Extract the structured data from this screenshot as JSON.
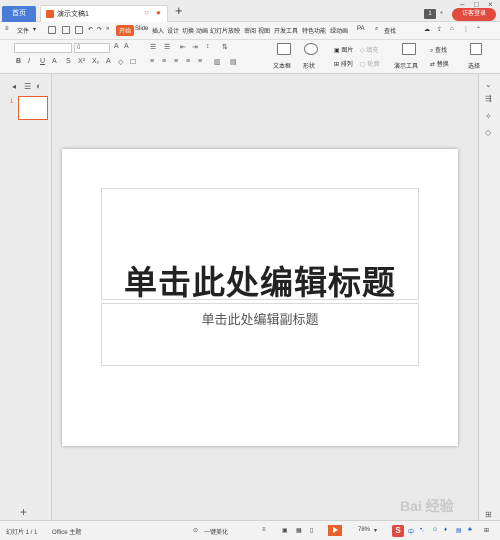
{
  "titlebar": {
    "home_tab": "首页",
    "doc_tab": "演示文稿1",
    "add_tab": "+",
    "badge": "1",
    "login": "访客登录",
    "min": "–",
    "max": "□",
    "close": "×"
  },
  "menu": {
    "file": "文件",
    "tabs": [
      "开始",
      "Slide",
      "插入",
      "设计",
      "切换",
      "动画",
      "幻灯片放映",
      "审阅",
      "视图",
      "开发工具",
      "特色功能",
      "绿动画",
      "PA"
    ],
    "search": "查找"
  },
  "ribbon": {
    "font_size": "0",
    "textbox": "文本框",
    "shape": "形状",
    "picture": "图片",
    "fill": "填充",
    "arrange": "排列",
    "outline": "轮廓",
    "present_tools": "演示工具",
    "find": "查找",
    "replace": "替换",
    "select": "选择"
  },
  "slides": {
    "number": "1"
  },
  "slide": {
    "title": "单击此处编辑标题",
    "subtitle": "单击此处编辑副标题"
  },
  "statusbar": {
    "slide_count": "幻灯片 1 / 1",
    "theme": "Office 主题",
    "beautify": "一键美化",
    "zoom": "78%",
    "ime_chars": "中",
    "ime_logo": "S"
  },
  "watermark": "Bai 经验",
  "colors": {
    "accent": "#e8612c",
    "home_tab": "#4a7bd6",
    "login": "#e04a3f"
  }
}
